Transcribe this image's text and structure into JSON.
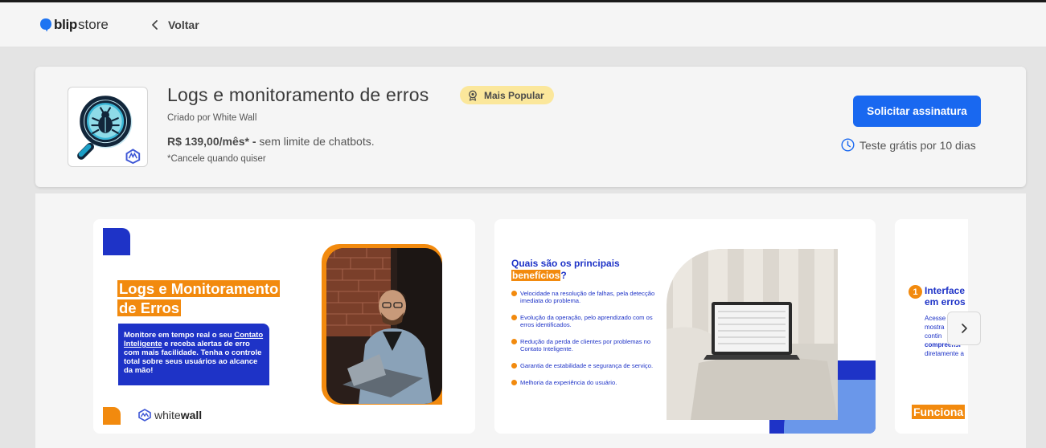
{
  "header": {
    "logo_bold": "blip",
    "logo_light": "store",
    "back_label": "Voltar"
  },
  "product": {
    "title": "Logs e monitoramento de erros",
    "badge": "Mais Popular",
    "creator": "Criado por White Wall",
    "price": "R$ 139,00/mês* -",
    "price_note": " sem limite de chatbots.",
    "cancel_note": "*Cancele quando quiser",
    "cta_label": "Solicitar assinatura",
    "trial_label": "Teste grátis por 10 dias"
  },
  "gallery": {
    "slide1": {
      "title": "Logs e Monitoramento de Erros",
      "desc_pre": "Monitore em tempo real o seu ",
      "desc_strong": "Contato Inteligente",
      "desc_post": " e receba alertas de erro com mais facilidade. Tenha o controle total sobre seus usuários ao alcance da mão!",
      "brand_light": "white",
      "brand_bold": "wall"
    },
    "slide2": {
      "title_pre": "Quais são os principais ",
      "title_hl": "benefícios",
      "title_post": "?",
      "items": [
        "Velocidade na resolução de falhas, pela detecção imediata do problema.",
        "Evolução da operação, pelo aprendizado com os erros identificados.",
        "Redução da perda de clientes por problemas no Contato Inteligente.",
        "Garantia de estabilidade e segurança de serviço.",
        "Melhoria da experiência do usuário."
      ]
    },
    "slide3": {
      "num": "1",
      "title_l1": "Interface",
      "title_l2": "em erros",
      "body": [
        "Acesse",
        "mostra",
        "contin",
        "compreensi",
        "diretamente a"
      ],
      "footer": "Funciona"
    }
  },
  "colors": {
    "accent": "#1968f0",
    "brand_blue": "#1e33c7",
    "brand_orange": "#f28a0e",
    "badge_bg": "#fbe79b"
  },
  "icons": [
    "blip-bubble-icon",
    "chevron-left-icon",
    "bug-magnifier-icon",
    "whitewall-icon",
    "badge-award-icon",
    "clock-icon",
    "chevron-right-icon"
  ]
}
